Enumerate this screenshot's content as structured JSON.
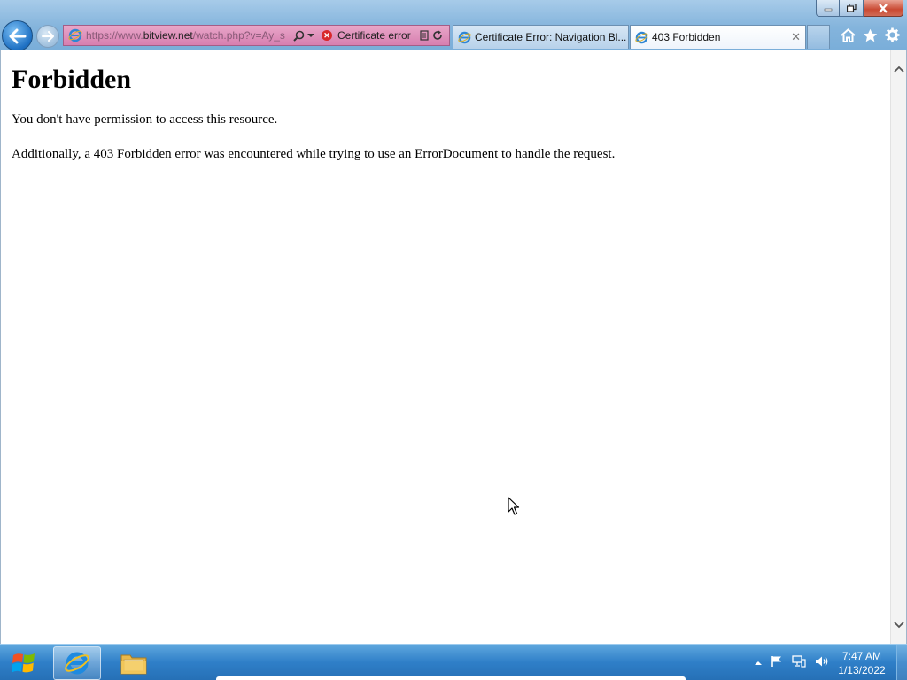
{
  "browser": {
    "address": {
      "url_prefix": "https://www.",
      "url_domain": "bitview.net",
      "url_path": "/watch.php?v=Ay_s",
      "certificate_error": "Certificate error"
    },
    "tabs": [
      {
        "label": "Certificate Error: Navigation Bl...",
        "active": false
      },
      {
        "label": "403 Forbidden",
        "active": true
      }
    ]
  },
  "page": {
    "heading": "Forbidden",
    "paragraphs": [
      "You don't have permission to access this resource.",
      "Additionally, a 403 Forbidden error was encountered while trying to use an ErrorDocument to handle the request."
    ]
  },
  "taskbar": {
    "clock_time": "7:47 AM",
    "clock_date": "1/13/2022"
  },
  "icons": {
    "back": "back-arrow-icon",
    "forward": "forward-arrow-icon",
    "home": "home-icon",
    "favorites": "star-icon",
    "tools": "gear-icon"
  },
  "colors": {
    "address_error_bg": "#d77fb0",
    "cert_error_icon": "#d8282a",
    "taskbar": "#2f7fc8"
  }
}
